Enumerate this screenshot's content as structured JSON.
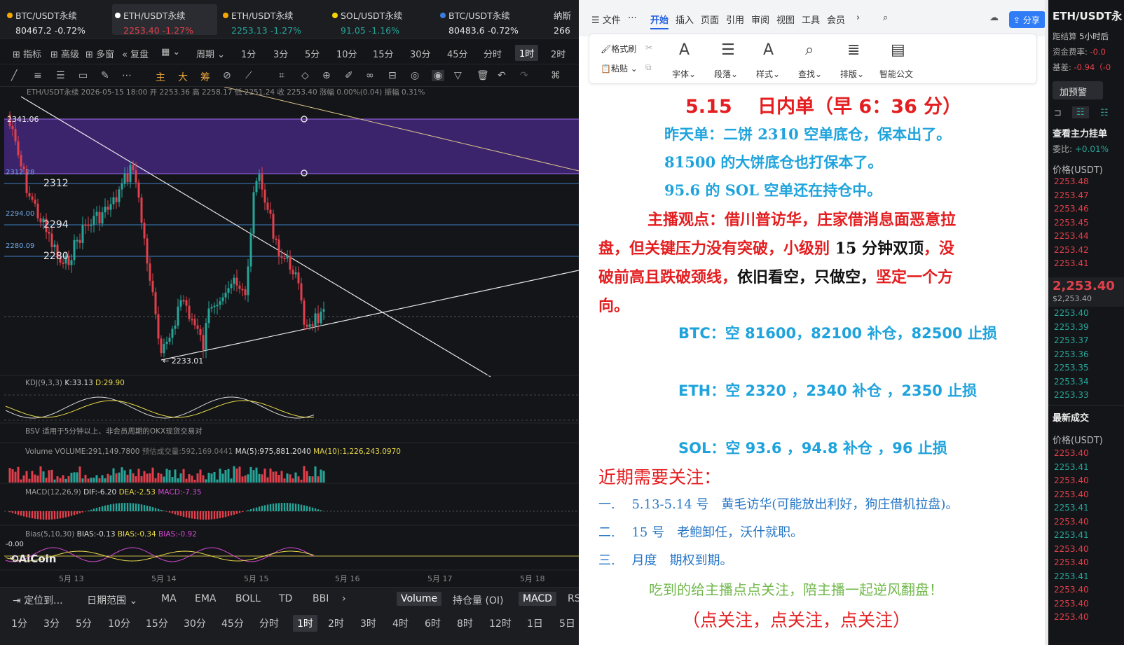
{
  "tickers": [
    {
      "name": "BTC/USDT永续",
      "price": "80467.2",
      "change": "-0.72%",
      "dot": "#f7a600"
    },
    {
      "name": "ETH/USDT永续",
      "price": "2253.40",
      "change": "-1.27%",
      "dot": "#ffffff"
    },
    {
      "name": "ETH/USDT永续",
      "price": "2253.13",
      "change": "-1.27%",
      "dot": "#f7a600"
    },
    {
      "name": "SOL/USDT永续",
      "price": "91.05",
      "change": "-1.16%",
      "dot": "#f7d300"
    },
    {
      "name": "BTC/USDT永续",
      "price": "80483.6",
      "change": "-0.72%",
      "dot": "#3b7ddd"
    },
    {
      "name": "纳斯",
      "price": "266",
      "change": "",
      "dot": ""
    }
  ],
  "menu": [
    "指标",
    "高级",
    "多窗",
    "复盘",
    "周期",
    "1分",
    "3分",
    "5分",
    "10分",
    "15分",
    "30分",
    "45分",
    "分时",
    "1时",
    "2时"
  ],
  "menu_selected": "1时",
  "chart": {
    "info_line": "ETH/USDT永续  2026-05-15 18:00  开 2253.36  高 2258.17  低 2251.24  收 2253.40  涨幅 0.00%(0.04)  振幅 0.31%",
    "level_labels": [
      "2341.06",
      "2312.28",
      "2294.00",
      "2280.09"
    ],
    "line_labels": [
      "2312",
      "2294",
      "2280"
    ],
    "low_label": "2233.01",
    "kdj": {
      "title": "KDJ(9,3,3)",
      "k": "K:33.13",
      "d": "D:29.90"
    },
    "bsv": {
      "title": "BSV",
      "note": "适用于5分钟以上、非会员周期的OKX现货交易对"
    },
    "volume": {
      "title": "Volume",
      "value": "VOLUME:291,149.7800",
      "est": "预估成交量:592,169.0441",
      "ma5": "MA(5):975,881.2040",
      "ma10": "MA(10):1,226,243.0970"
    },
    "macd": {
      "title": "MACD(12,26,9)",
      "dif": "DIF:-6.20",
      "dea": "DEA:-2.53",
      "macd": "MACD:-7.35"
    },
    "bias": {
      "title": "Bias(5,10,30)",
      "b1": "BIAS:-0.13",
      "b2": "BIAS:-0.34",
      "b3": "BIAS:-0.92",
      "zero": "-0.00"
    },
    "watermark": "AiCoin",
    "dates": [
      "5月 13",
      "5月 14",
      "5月 15",
      "5月 16",
      "5月 17",
      "5月 18"
    ]
  },
  "bottom1": [
    "定位到...",
    "日期范围",
    "MA",
    "EMA",
    "BOLL",
    "TD",
    "BBI",
    "Volume",
    "持仓量 (OI)",
    "MACD",
    "RS"
  ],
  "bottom2": [
    "1分",
    "3分",
    "5分",
    "10分",
    "15分",
    "30分",
    "45分",
    "分时",
    "1时",
    "2时",
    "3时",
    "4时",
    "6时",
    "8时",
    "12时",
    "1日",
    "5日"
  ],
  "doc": {
    "menu": [
      "文件",
      "开始",
      "插入",
      "页面",
      "引用",
      "审阅",
      "视图",
      "工具",
      "会员"
    ],
    "share": "分享",
    "ribbon": [
      "格式刷",
      "粘贴",
      "字体",
      "段落",
      "样式",
      "查找",
      "排版",
      "智能公文"
    ],
    "title": "5.15　 日内单（早 6：36 分）",
    "y1": "昨天单：二饼 2310 空单底仓，保本出了。",
    "y2": "81500 的大饼底仓也打保本了。",
    "y3": "95.6 的 SOL 空单还在持仓中。",
    "v1": "主播观点：借川普访华，庄家借消息面恶意拉",
    "v2a": "盘，但关键压力没有突破，小级别 ",
    "v2b": "15 分钟双顶",
    "v2c": "，没",
    "v3a": "破前高且跌破颈线，",
    "v3b": "依旧看空，只做空，",
    "v3c": "坚定一个方",
    "v4": "向。",
    "btc": "BTC：空 81600，82100 补仓，82500 止损",
    "eth": "ETH：空 2320 ，2340 补仓 ，2350 止损",
    "sol": "SOL：空 93.6 ，94.8 补仓 ，96 止损",
    "focus": "近期需要关注：",
    "f1": "一.　 5.13-5.14 号　黄毛访华(可能放出利好，狗庄借机拉盘)。",
    "f2": "二.　 15 号　老鲍卸任，沃什就职。",
    "f3": "三.　 月度　期权到期。",
    "c1": "吃到的给主播点点关注，陪主播一起逆风翻盘！",
    "c2": "（点关注，点关注，点关注）"
  },
  "right": {
    "pair": "ETH/USDT永",
    "settle": "距结算",
    "settle_v": "5小时后",
    "funding": "资金费率:",
    "funding_v": "-0.0",
    "basis": "基差:",
    "basis_v": "-0.94（-0",
    "btn": "加预警",
    "mainbook": "查看主力挂单",
    "ratio": "委比:",
    "ratio_v": "+0.01%",
    "price_hdr": "价格(USDT)",
    "asks": [
      "2253.48",
      "2253.47",
      "2253.46",
      "2253.45",
      "2253.44",
      "2253.42",
      "2253.41"
    ],
    "last": "2,253.40",
    "last_usd": "$2,253.40",
    "bids": [
      "2253.40",
      "2253.39",
      "2253.37",
      "2253.36",
      "2253.35",
      "2253.34",
      "2253.33"
    ],
    "trades_hdr": "最新成交",
    "trades_price_hdr": "价格(USDT)",
    "trades": [
      {
        "p": "2253.40",
        "c": "#e0404b"
      },
      {
        "p": "2253.41",
        "c": "#26a69a"
      },
      {
        "p": "2253.40",
        "c": "#e0404b"
      },
      {
        "p": "2253.40",
        "c": "#e0404b"
      },
      {
        "p": "2253.41",
        "c": "#26a69a"
      },
      {
        "p": "2253.40",
        "c": "#e0404b"
      },
      {
        "p": "2253.41",
        "c": "#26a69a"
      },
      {
        "p": "2253.40",
        "c": "#e0404b"
      },
      {
        "p": "2253.40",
        "c": "#e0404b"
      },
      {
        "p": "2253.41",
        "c": "#26a69a"
      },
      {
        "p": "2253.40",
        "c": "#e0404b"
      },
      {
        "p": "2253.40",
        "c": "#e0404b"
      },
      {
        "p": "2253.40",
        "c": "#e0404b"
      }
    ]
  }
}
